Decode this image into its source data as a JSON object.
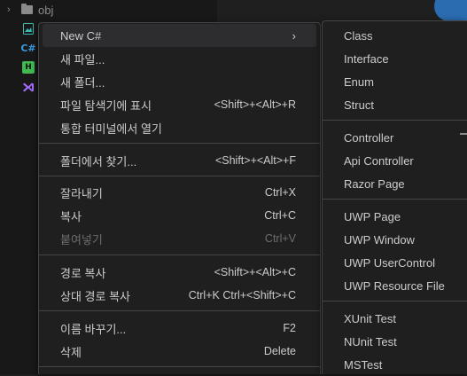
{
  "explorer": {
    "folder_label": "obj",
    "file_icons": [
      {
        "icon": "image-file-icon",
        "glyph": "🖻",
        "color": "#3fb9b0"
      },
      {
        "icon": "csharp-file-icon",
        "glyph": "C#",
        "color": "#3b9be0"
      },
      {
        "icon": "h-file-icon",
        "glyph": "H",
        "color": "#3fb950"
      },
      {
        "icon": "visual-studio-icon",
        "glyph": "⋈",
        "color": "#a66cff"
      }
    ]
  },
  "context_menu": {
    "new_csharp": "New C#",
    "new_file": "새 파일...",
    "new_folder": "새 폴더...",
    "reveal": "파일 탐색기에 표시",
    "reveal_key": "<Shift>+<Alt>+R",
    "open_terminal": "통합 터미널에서 열기",
    "find_in_folder": "폴더에서 찾기...",
    "find_in_folder_key": "<Shift>+<Alt>+F",
    "cut": "잘라내기",
    "cut_key": "Ctrl+X",
    "copy": "복사",
    "copy_key": "Ctrl+C",
    "paste": "붙여넣기",
    "paste_key": "Ctrl+V",
    "copy_path": "경로 복사",
    "copy_path_key": "<Shift>+<Alt>+C",
    "copy_relative_path": "상대 경로 복사",
    "copy_relative_path_key": "Ctrl+K Ctrl+<Shift>+C",
    "rename": "이름 바꾸기...",
    "rename_key": "F2",
    "delete": "삭제",
    "delete_key": "Delete"
  },
  "submenu": {
    "items": [
      "Class",
      "Interface",
      "Enum",
      "Struct",
      "Controller",
      "Api Controller",
      "Razor Page",
      "UWP Page",
      "UWP Window",
      "UWP UserControl",
      "UWP Resource File",
      "XUnit Test",
      "NUnit Test",
      "MSTest"
    ]
  },
  "colors": {
    "menu_bg": "#1f1f1f",
    "separator": "#454545",
    "text": "#cccccc",
    "disabled_text": "#6e6e6e"
  }
}
